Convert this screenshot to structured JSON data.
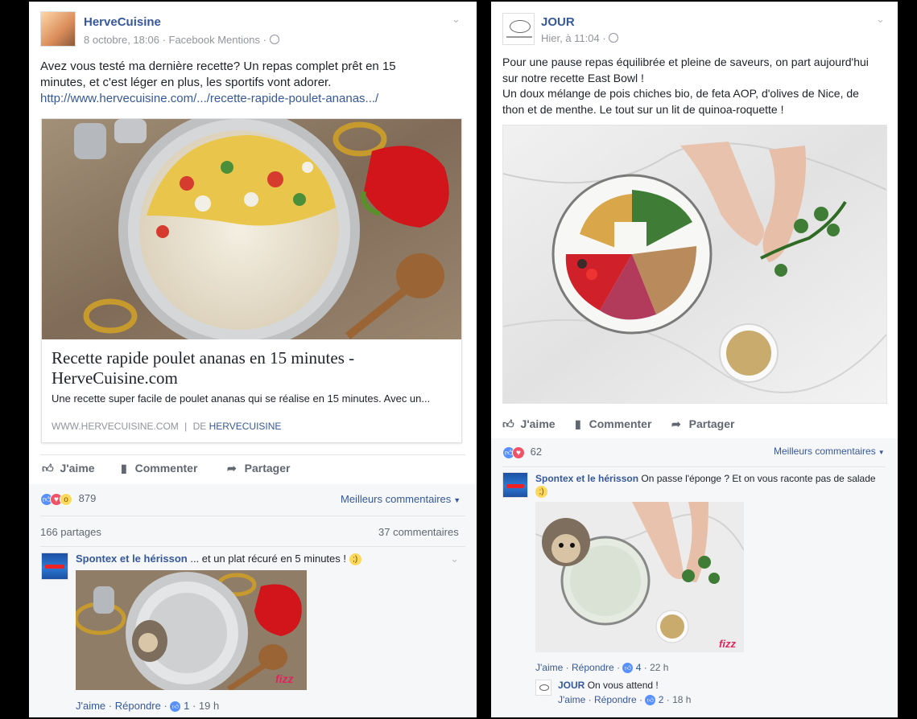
{
  "left_post": {
    "author": "HerveCuisine",
    "meta": "8 octobre, 18:06 · Facebook Mentions ·",
    "text_lines": [
      "Avez vous testé ma dernière recette? Un repas complet prêt en 15",
      "minutes, et c'est léger en plus, les sportifs vont adorer."
    ],
    "url": "http://www.hervecuisine.com/.../recette-rapide-poulet-ananas.../",
    "card": {
      "title_lines": [
        "Recette rapide poulet ananas en 15 minutes -",
        "HerveCuisine.com"
      ],
      "description": "Une recette super facile de poulet ananas qui se réalise en 15 minutes. Avec un...",
      "domain": "WWW.HERVECUISINE.COM",
      "separator": "|",
      "by_prefix": "DE",
      "by_name": "HERVECUISINE"
    },
    "actions": {
      "like": "J'aime",
      "comment": "Commenter",
      "share": "Partager"
    },
    "reactions_count": "879",
    "best_comments": "Meilleurs commentaires",
    "shares": "166 partages",
    "comments_count": "37 commentaires",
    "comment": {
      "author": "Spontex et le hérisson",
      "text": "... et un plat récuré en 5 minutes !",
      "like": "J'aime",
      "reply": "Répondre",
      "likes": "1",
      "time": "19 h",
      "watermark": "fizz"
    }
  },
  "right_post": {
    "author": "JOUR",
    "meta": "Hier, à 11:04 ·",
    "text_lines": [
      "Pour une pause repas équilibrée et pleine de saveurs, on part aujourd'hui",
      "sur notre recette East Bowl !",
      "Un doux mélange de pois chiches bio, de feta AOP, d'olives de Nice, de",
      "thon et de menthe. Le tout sur un lit de quinoa-roquette !"
    ],
    "actions": {
      "like": "J'aime",
      "comment": "Commenter",
      "share": "Partager"
    },
    "reactions_count": "62",
    "best_comments": "Meilleurs commentaires",
    "comment": {
      "author": "Spontex et le hérisson",
      "text": "On passe l'éponge ? Et on vous raconte pas de salade",
      "like": "J'aime",
      "reply": "Répondre",
      "likes": "4",
      "time": "22 h",
      "watermark": "fizz"
    },
    "reply": {
      "author": "JOUR",
      "text": "On vous attend !",
      "like": "J'aime",
      "reply": "Répondre",
      "likes": "2",
      "time": "18 h"
    }
  },
  "colors": {
    "link_blue": "#365899",
    "meta_grey": "#90949c",
    "like_blue": "#5890ff",
    "love_red": "#f25268"
  }
}
